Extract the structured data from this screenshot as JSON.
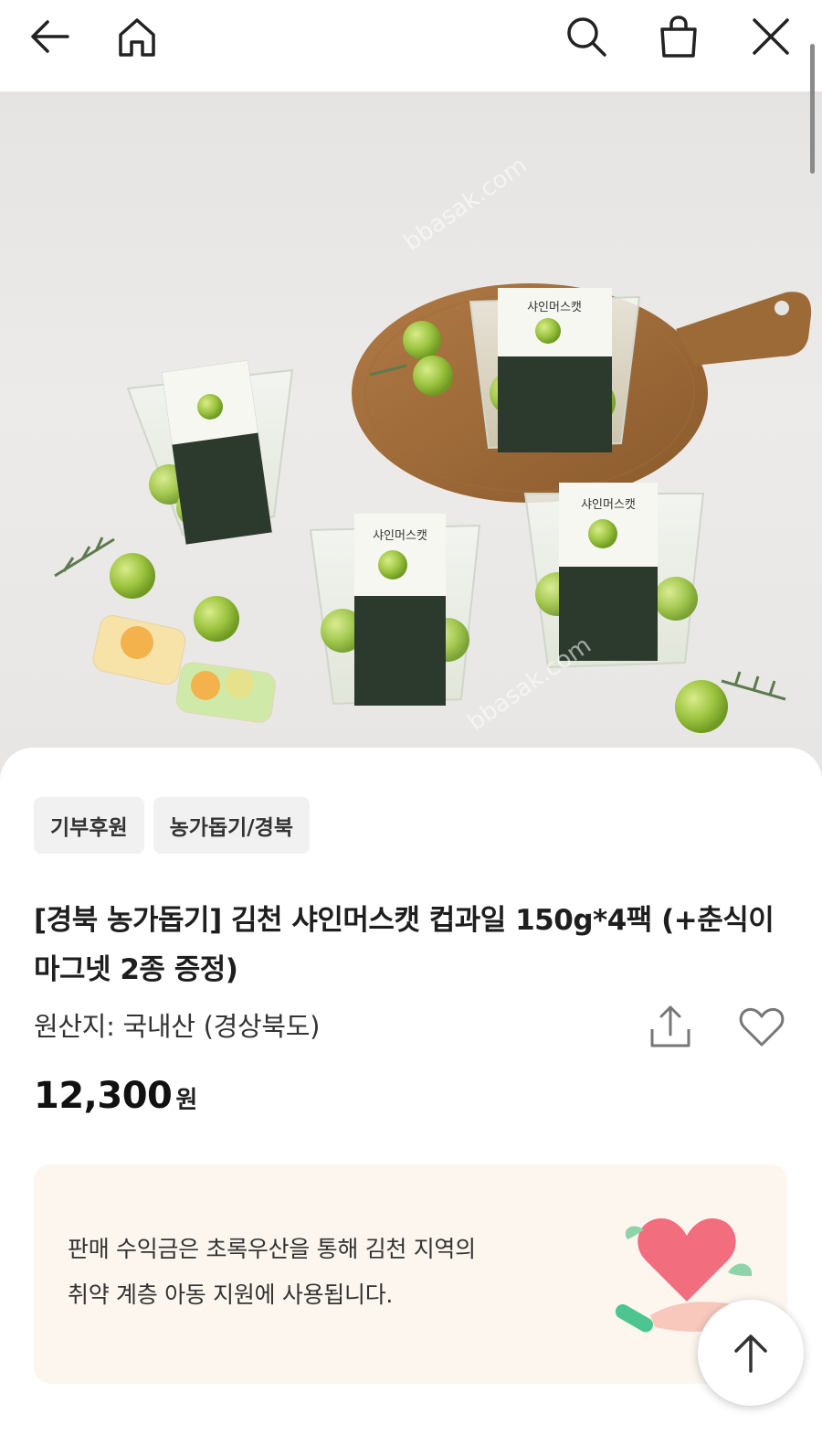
{
  "nav": {
    "back_icon": "arrow-left-icon",
    "home_icon": "home-icon",
    "search_icon": "search-icon",
    "cart_icon": "shopping-bag-icon",
    "close_icon": "close-icon"
  },
  "hero": {
    "watermark_1": "bbasak.com",
    "watermark_2": "bbasak.com",
    "package_label": "샤인머스캣"
  },
  "tags": [
    "기부후원",
    "농가돕기/경북"
  ],
  "product": {
    "title": "[경북 농가돕기] 김천 샤인머스캣 컵과일 150g*4팩 (+춘식이 마그넷 2종 증정)",
    "origin": "원산지: 국내산 (경상북도)",
    "price": "12,300",
    "currency": "원",
    "share_icon": "share-icon",
    "like_icon": "heart-outline-icon"
  },
  "donation": {
    "line1": "판매 수익금은 초록우산을 통해 김천 지역의",
    "line2": "취약 계층 아동 지원에 사용됩니다.",
    "illustration": "heart-hand-illustration"
  },
  "scroll_top_icon": "arrow-up-icon",
  "colors": {
    "tag_bg": "#f1f1f1",
    "donation_bg": "#fcf6ef",
    "heart": "#f26d7d",
    "leaf": "#8fd3a8",
    "grape": "#a6c94a"
  }
}
